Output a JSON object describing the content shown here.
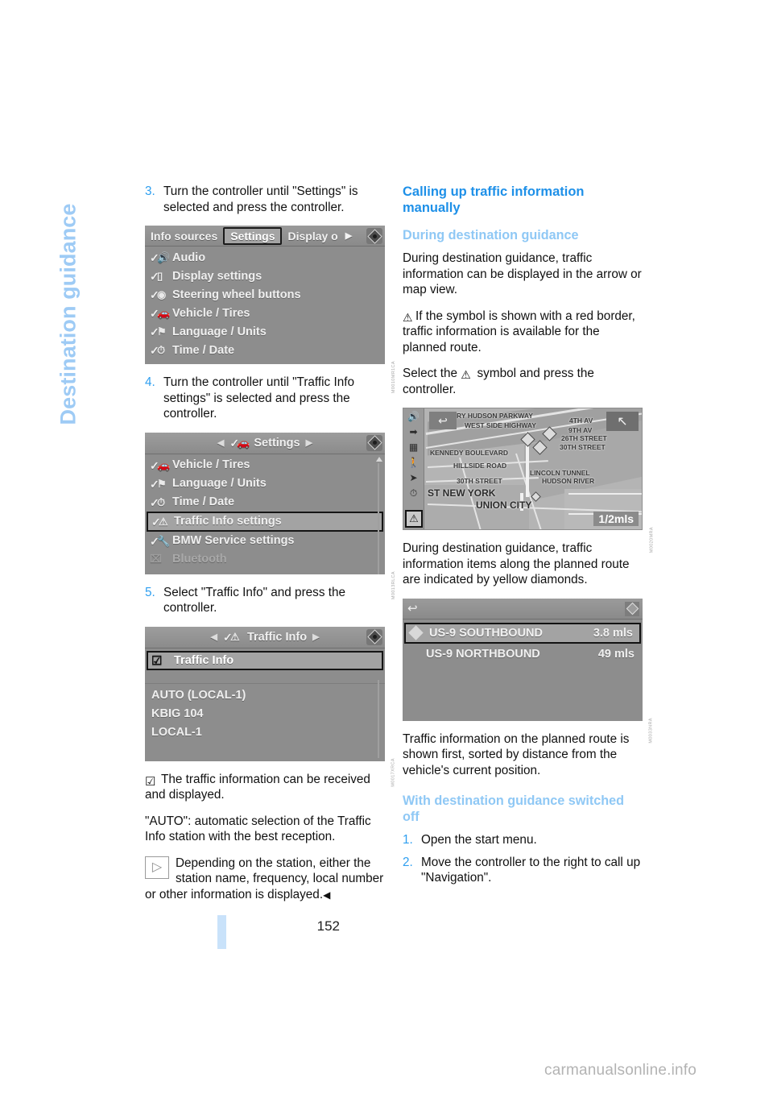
{
  "chapter": {
    "title": "Destination guidance"
  },
  "page": {
    "number": "152",
    "watermark": "carmanualsonline.info"
  },
  "left_column": {
    "step3": {
      "num": "3.",
      "text": "Turn the controller until \"Settings\" is selected and press the controller."
    },
    "figure_settings": {
      "code": "M0010MR1CA",
      "tabs": [
        {
          "label": "Info sources",
          "selected": false
        },
        {
          "label": "Settings",
          "selected": true
        },
        {
          "label": "Display o",
          "selected": false
        }
      ],
      "next_arrow": "▶",
      "items": [
        {
          "label": "Audio",
          "icon": "check-speaker-icon"
        },
        {
          "label": "Display settings",
          "icon": "check-display-icon"
        },
        {
          "label": "Steering wheel buttons",
          "icon": "check-steering-wheel-icon"
        },
        {
          "label": "Vehicle / Tires",
          "icon": "check-car-icon"
        },
        {
          "label": "Language / Units",
          "icon": "check-flag-icon"
        },
        {
          "label": "Time / Date",
          "icon": "check-clock-icon"
        }
      ]
    },
    "step4": {
      "num": "4.",
      "text": "Turn the controller until \"Traffic Info settings\" is selected and press the controller."
    },
    "figure_settings2": {
      "code": "M0013RLCA",
      "header": "Settings",
      "header_icon": "check-car-icon",
      "items": [
        {
          "label": "Vehicle / Tires",
          "icon": "check-car-icon",
          "highlighted": false
        },
        {
          "label": "Language / Units",
          "icon": "check-flag-icon",
          "highlighted": false
        },
        {
          "label": "Time / Date",
          "icon": "check-clock-icon",
          "highlighted": false
        },
        {
          "label": "Traffic Info settings",
          "icon": "check-warning-icon",
          "highlighted": true
        },
        {
          "label": "BMW Service settings",
          "icon": "check-service-icon",
          "highlighted": false
        },
        {
          "label": "Bluetooth",
          "icon": "bluetooth-icon",
          "highlighted": false
        }
      ]
    },
    "step5": {
      "num": "5.",
      "text": "Select \"Traffic Info\" and press the controller."
    },
    "figure_trafficinfo": {
      "code": "M0017XRCA",
      "header": "Traffic Info",
      "header_icon": "check-warning-icon",
      "checkbox_item": {
        "label": "Traffic Info",
        "icon": "checkbox-checked-icon"
      },
      "stations": [
        "AUTO (LOCAL-1)",
        "KBIG 104",
        "LOCAL-1"
      ]
    },
    "note_received": "The traffic information can be received and displayed.",
    "note_auto": "\"AUTO\": automatic selection of the Traffic Info station with the best reception.",
    "note_depending": "Depending on the station, either the station name, frequency, local number or other information is displayed.",
    "end_mark": "◀"
  },
  "right_column": {
    "section_title": "Calling up traffic information manually",
    "sub1_title": "During destination guidance",
    "p1": "During destination guidance, traffic information can be displayed in the arrow or map view.",
    "p2": "If the symbol is shown with a red border, traffic information is available for the planned route.",
    "p3_before": "Select the",
    "p3_after": "symbol and press the controller.",
    "figure_map": {
      "code": "M0020MRA",
      "scale": "1/2mls",
      "labels": [
        "RY HUDSON PARKWAY",
        "WEST SIDE HIGHWAY",
        "4TH AV",
        "9TH AV",
        "26TH STREET",
        "30TH STREET",
        "KENNEDY BOULEVARD",
        "HILLSIDE ROAD",
        "LINCOLN TUNNEL",
        "HUDSON RIVER",
        "30TH STREET",
        "ST NEW YORK",
        "UNION CITY"
      ],
      "sidebar_icons": [
        "speaker-icon",
        "arrow-dot-icon",
        "keypad-icon",
        "pedestrian-icon",
        "compass-arrow-icon",
        "clock-icon",
        "warning-triangle-icon"
      ]
    },
    "p4": "During destination guidance, traffic information items along the planned route are indicated by yellow diamonds.",
    "figure_list": {
      "code": "M0033NRA",
      "rows": [
        {
          "name": "US-9 SOUTHBOUND",
          "distance": "3.8 mls",
          "highlighted": true,
          "marker": "yellow-diamond-icon"
        },
        {
          "name": "US-9 NORTHBOUND",
          "distance": "49 mls",
          "highlighted": false,
          "marker": ""
        }
      ]
    },
    "p5": "Traffic information on the planned route is shown first, sorted by distance from the vehicle's current position.",
    "sub2_title": "With destination guidance switched off",
    "step1": {
      "num": "1.",
      "text": "Open the start menu."
    },
    "step2": {
      "num": "2.",
      "text": "Move the controller to the right to call up \"Navigation\"."
    }
  },
  "colors": {
    "heading_blue": "#1e90e8",
    "subheading_blue": "#8fc8f5",
    "step_number_blue": "#2f9ff0",
    "chapter_tab_blue": "#9ecbf5",
    "page_bar_blue": "#c9e2fa"
  }
}
